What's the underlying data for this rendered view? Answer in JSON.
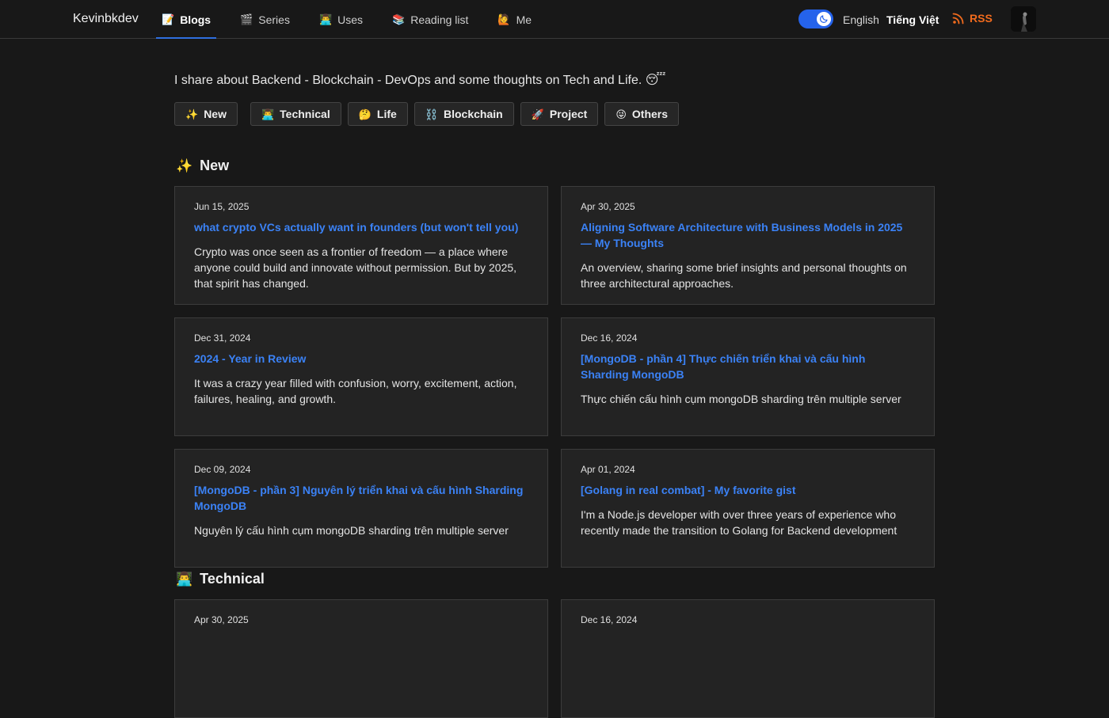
{
  "header": {
    "brand": "Kevinbkdev",
    "nav": [
      {
        "label": "Blogs",
        "emoji": "📝",
        "active": true
      },
      {
        "label": "Series",
        "emoji": "🎬",
        "active": false
      },
      {
        "label": "Uses",
        "emoji": "👨‍💻",
        "active": false
      },
      {
        "label": "Reading list",
        "emoji": "📚",
        "active": false
      },
      {
        "label": "Me",
        "emoji": "🙋",
        "active": false
      }
    ],
    "theme_toggle": "dark",
    "lang_en": "English",
    "lang_vi": "Tiếng Việt",
    "rss": "RSS"
  },
  "intro": "I share about Backend - Blockchain - DevOps and some thoughts on Tech and Life. 😴",
  "filters": [
    {
      "emoji": "✨",
      "label": "New"
    },
    {
      "emoji": "👨‍💻",
      "label": "Technical"
    },
    {
      "emoji": "🤔",
      "label": "Life"
    },
    {
      "emoji": "⛓️",
      "label": "Blockchain"
    },
    {
      "emoji": "🚀",
      "label": "Project"
    },
    {
      "emoji": "😜",
      "label": "Others"
    }
  ],
  "sections": [
    {
      "emoji": "✨",
      "title": "New",
      "cards": [
        {
          "date": "Jun 15, 2025",
          "title": "what crypto VCs actually want in founders (but won't tell you)",
          "desc": "Crypto was once seen as a frontier of freedom — a place where anyone could build and innovate without permission. But by 2025, that spirit has changed."
        },
        {
          "date": "Apr 30, 2025",
          "title": "Aligning Software Architecture with Business Models in 2025 — My Thoughts",
          "desc": "An overview, sharing some brief insights and personal thoughts on three architectural approaches."
        },
        {
          "date": "Dec 31, 2024",
          "title": "2024 - Year in Review",
          "desc": "It was a crazy year filled with confusion, worry, excitement, action, failures, healing, and growth."
        },
        {
          "date": "Dec 16, 2024",
          "title": "[MongoDB - phần 4] Thực chiến triển khai và cấu hình Sharding MongoDB",
          "desc": "Thực chiến cấu hình cụm mongoDB sharding trên multiple server"
        },
        {
          "date": "Dec 09, 2024",
          "title": "[MongoDB - phần 3] Nguyên lý triển khai và cấu hình Sharding MongoDB",
          "desc": "Nguyên lý cấu hình cụm mongoDB sharding trên multiple server"
        },
        {
          "date": "Apr 01, 2024",
          "title": "[Golang in real combat] - My favorite gist",
          "desc": "I'm a Node.js developer with over three years of experience who recently made the transition to Golang for Backend development"
        }
      ]
    },
    {
      "emoji": "👨‍💻",
      "title": "Technical",
      "cards": [
        {
          "date": "Apr 30, 2025",
          "title": "",
          "desc": ""
        },
        {
          "date": "Dec 16, 2024",
          "title": "",
          "desc": ""
        }
      ]
    }
  ]
}
